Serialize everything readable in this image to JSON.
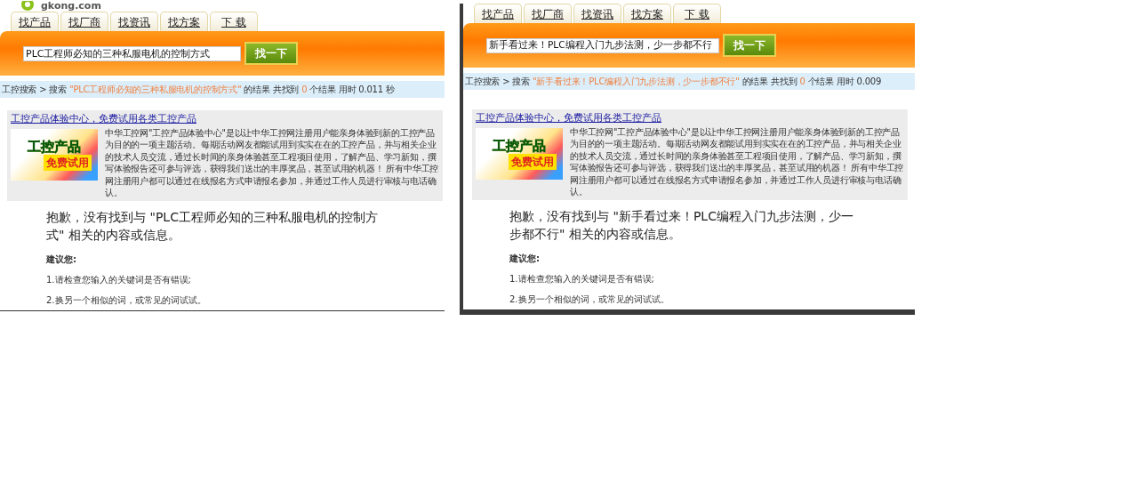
{
  "panels": [
    {
      "framed": false,
      "logo_text": "gkong.com",
      "tabs": [
        {
          "label": "找产品"
        },
        {
          "label": "找厂商"
        },
        {
          "label": "找资讯"
        },
        {
          "label": "找方案"
        },
        {
          "label": "下 载"
        }
      ],
      "search": {
        "value": "PLC工程师必知的三种私服电机的控制方式",
        "button": "找一下"
      },
      "breadcrumb": {
        "home": "工控搜索",
        "separator": ">",
        "label": "搜索",
        "query": "\"PLC工程师必知的三种私服电机的控制方式\"",
        "result_prefix": "的结果 共找到",
        "count": "0",
        "result_suffix": "个结果 用时 0.011 秒"
      },
      "promo": {
        "link": "工控产品体验中心，免费试用各类工控产品",
        "banner_title": "工控产品",
        "banner_subtitle": "免费试用",
        "text": "中华工控网\"工控产品体验中心\"是以让中华工控网注册用户能亲身体验到新的工控产品为目的的一项主题活动。每期活动网友都能试用到实实在在的工控产品，并与相关企业的技术人员交流，通过长时间的亲身体验甚至工程项目使用，了解产品、学习新知，撰写体验报告还可参与评选，获得我们送出的丰厚奖品，甚至试用的机器！ 所有中华工控网注册用户都可以通过在线报名方式申请报名参加，并通过工作人员进行审核与电话确认。"
      },
      "no_result": {
        "message": "抱歉，没有找到与 \"PLC工程师必知的三种私服电机的控制方式\" 相关的内容或信息。",
        "advice_title": "建议您:",
        "advice": [
          "1.请检查您输入的关键词是否有错误;",
          "2.换另一个相似的词，或常见的词试试。"
        ]
      }
    },
    {
      "framed": true,
      "tabs": [
        {
          "label": "找产品"
        },
        {
          "label": "找厂商"
        },
        {
          "label": "找资讯"
        },
        {
          "label": "找方案"
        },
        {
          "label": "下 载"
        }
      ],
      "search": {
        "value": "新手看过来！PLC编程入门九步法测，少一步都不行",
        "button": "找一下"
      },
      "breadcrumb": {
        "home": "工控搜索",
        "separator": ">",
        "label": "搜索",
        "query": "\"新手看过来！PLC编程入门九步法测，少一步都不行\"",
        "result_prefix": "的结果 共找到",
        "count": "0",
        "result_suffix": "个结果 用时 0.009"
      },
      "promo": {
        "link": "工控产品体验中心，免费试用各类工控产品",
        "banner_title": "工控产品",
        "banner_subtitle": "免费试用",
        "text": "中华工控网\"工控产品体验中心\"是以让中华工控网注册用户能亲身体验到新的工控产品为目的的一项主题活动。每期活动网友都能试用到实实在在的工控产品，并与相关企业的技术人员交流，通过长时间的亲身体验甚至工程项目使用，了解产品、学习新知，撰写体验报告还可参与评选，获得我们送出的丰厚奖品，甚至试用的机器！ 所有中华工控网注册用户都可以通过在线报名方式申请报名参加，并通过工作人员进行审核与电话确认。"
      },
      "no_result": {
        "message": "抱歉，没有找到与 \"新手看过来！PLC编程入门九步法测，少一步都不行\" 相关的内容或信息。",
        "advice_title": "建议您:",
        "advice": [
          "1.请检查您输入的关键词是否有错误;",
          "2.换另一个相似的词，或常见的词试试。"
        ]
      }
    }
  ]
}
